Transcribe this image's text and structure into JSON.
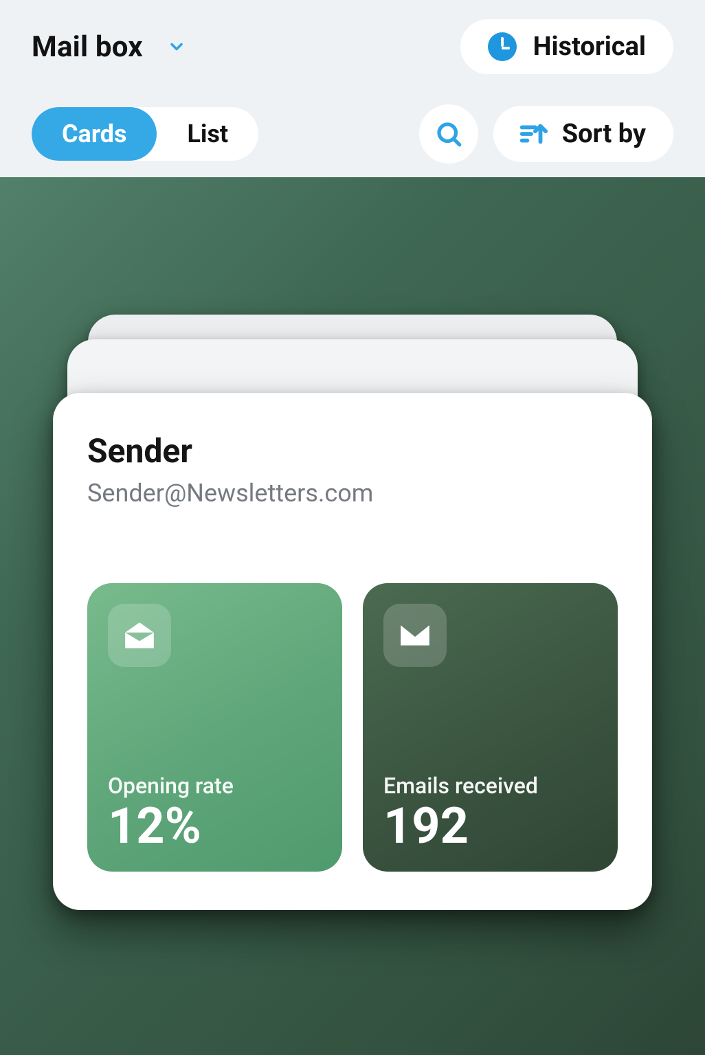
{
  "header": {
    "title": "Mail box",
    "historical_label": "Historical",
    "view_toggle": {
      "cards": "Cards",
      "list": "List",
      "active": "cards"
    },
    "sort_label": "Sort by"
  },
  "card": {
    "sender_title": "Sender",
    "sender_email": "Sender@Newsletters.com",
    "stats": {
      "opening_rate": {
        "label": "Opening rate",
        "value": "12%"
      },
      "emails_received": {
        "label": "Emails received",
        "value": "192"
      }
    }
  },
  "colors": {
    "accent": "#35a9e6"
  }
}
